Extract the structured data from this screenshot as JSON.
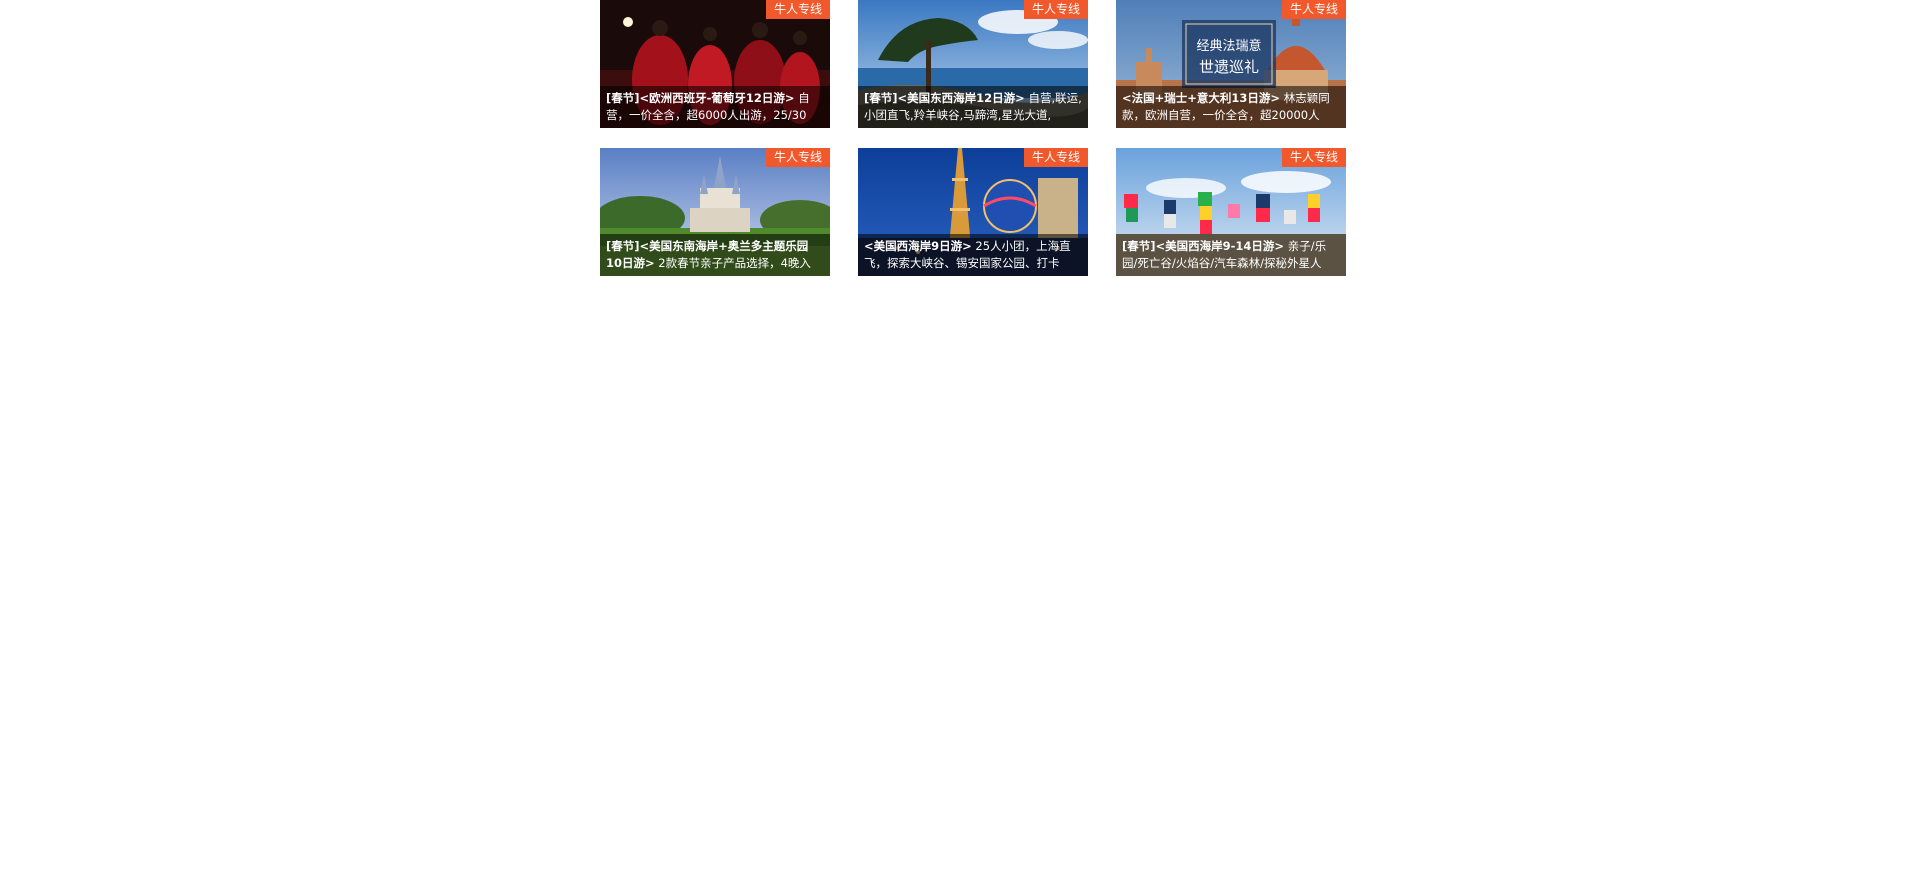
{
  "badge_label": "牛人专线",
  "cards": [
    {
      "title": "[春节]<欧洲西班牙-葡萄牙12日游>",
      "desc": " 自营，一价全含，超6000人出游，25/30",
      "image": "flamenco-dancers-photo"
    },
    {
      "title": "[春节]<美国东西海岸12日游>",
      "desc": " 自营,联运,小团直飞,羚羊峡谷,马蹄湾,星光大道,",
      "image": "pacific-coast-cypress-photo"
    },
    {
      "title": "<法国+瑞士+意大利13日游>",
      "desc": " 林志颖同款，欧洲自营，一价全含，超20000人",
      "image": "florence-duomo-photo",
      "overlay_title": "经典法瑞意",
      "overlay_subtitle": "世遗巡礼"
    },
    {
      "title": "[春节]<美国东南海岸+奥兰多主题乐园10日游>",
      "desc": " 2款春节亲子产品选择，4晚入",
      "image": "theme-park-castle-photo"
    },
    {
      "title": "<美国西海岸9日游>",
      "desc": " 25人小团，上海直飞，探索大峡谷、锡安国家公园、打卡",
      "image": "las-vegas-paris-photo"
    },
    {
      "title": "[春节]<美国西海岸9-14日游>",
      "desc": " 亲子/乐园/死亡谷/火焰谷/汽车森林/探秘外星人",
      "image": "seven-magic-mountains-photo"
    }
  ],
  "colors": {
    "badge": "#f1582b",
    "caption_bg": "rgba(0,0,0,0.55)",
    "page_bg": "#ffffff"
  }
}
